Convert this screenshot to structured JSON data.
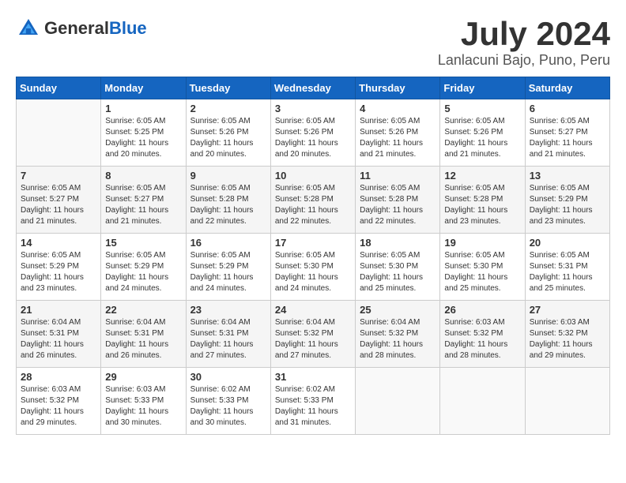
{
  "header": {
    "logo_general": "General",
    "logo_blue": "Blue",
    "month_year": "July 2024",
    "location": "Lanlacuni Bajo, Puno, Peru"
  },
  "days_of_week": [
    "Sunday",
    "Monday",
    "Tuesday",
    "Wednesday",
    "Thursday",
    "Friday",
    "Saturday"
  ],
  "weeks": [
    [
      {
        "day": "",
        "info": ""
      },
      {
        "day": "1",
        "info": "Sunrise: 6:05 AM\nSunset: 5:25 PM\nDaylight: 11 hours\nand 20 minutes."
      },
      {
        "day": "2",
        "info": "Sunrise: 6:05 AM\nSunset: 5:26 PM\nDaylight: 11 hours\nand 20 minutes."
      },
      {
        "day": "3",
        "info": "Sunrise: 6:05 AM\nSunset: 5:26 PM\nDaylight: 11 hours\nand 20 minutes."
      },
      {
        "day": "4",
        "info": "Sunrise: 6:05 AM\nSunset: 5:26 PM\nDaylight: 11 hours\nand 21 minutes."
      },
      {
        "day": "5",
        "info": "Sunrise: 6:05 AM\nSunset: 5:26 PM\nDaylight: 11 hours\nand 21 minutes."
      },
      {
        "day": "6",
        "info": "Sunrise: 6:05 AM\nSunset: 5:27 PM\nDaylight: 11 hours\nand 21 minutes."
      }
    ],
    [
      {
        "day": "7",
        "info": "Sunrise: 6:05 AM\nSunset: 5:27 PM\nDaylight: 11 hours\nand 21 minutes."
      },
      {
        "day": "8",
        "info": "Sunrise: 6:05 AM\nSunset: 5:27 PM\nDaylight: 11 hours\nand 21 minutes."
      },
      {
        "day": "9",
        "info": "Sunrise: 6:05 AM\nSunset: 5:28 PM\nDaylight: 11 hours\nand 22 minutes."
      },
      {
        "day": "10",
        "info": "Sunrise: 6:05 AM\nSunset: 5:28 PM\nDaylight: 11 hours\nand 22 minutes."
      },
      {
        "day": "11",
        "info": "Sunrise: 6:05 AM\nSunset: 5:28 PM\nDaylight: 11 hours\nand 22 minutes."
      },
      {
        "day": "12",
        "info": "Sunrise: 6:05 AM\nSunset: 5:28 PM\nDaylight: 11 hours\nand 23 minutes."
      },
      {
        "day": "13",
        "info": "Sunrise: 6:05 AM\nSunset: 5:29 PM\nDaylight: 11 hours\nand 23 minutes."
      }
    ],
    [
      {
        "day": "14",
        "info": "Sunrise: 6:05 AM\nSunset: 5:29 PM\nDaylight: 11 hours\nand 23 minutes."
      },
      {
        "day": "15",
        "info": "Sunrise: 6:05 AM\nSunset: 5:29 PM\nDaylight: 11 hours\nand 24 minutes."
      },
      {
        "day": "16",
        "info": "Sunrise: 6:05 AM\nSunset: 5:29 PM\nDaylight: 11 hours\nand 24 minutes."
      },
      {
        "day": "17",
        "info": "Sunrise: 6:05 AM\nSunset: 5:30 PM\nDaylight: 11 hours\nand 24 minutes."
      },
      {
        "day": "18",
        "info": "Sunrise: 6:05 AM\nSunset: 5:30 PM\nDaylight: 11 hours\nand 25 minutes."
      },
      {
        "day": "19",
        "info": "Sunrise: 6:05 AM\nSunset: 5:30 PM\nDaylight: 11 hours\nand 25 minutes."
      },
      {
        "day": "20",
        "info": "Sunrise: 6:05 AM\nSunset: 5:31 PM\nDaylight: 11 hours\nand 25 minutes."
      }
    ],
    [
      {
        "day": "21",
        "info": "Sunrise: 6:04 AM\nSunset: 5:31 PM\nDaylight: 11 hours\nand 26 minutes."
      },
      {
        "day": "22",
        "info": "Sunrise: 6:04 AM\nSunset: 5:31 PM\nDaylight: 11 hours\nand 26 minutes."
      },
      {
        "day": "23",
        "info": "Sunrise: 6:04 AM\nSunset: 5:31 PM\nDaylight: 11 hours\nand 27 minutes."
      },
      {
        "day": "24",
        "info": "Sunrise: 6:04 AM\nSunset: 5:32 PM\nDaylight: 11 hours\nand 27 minutes."
      },
      {
        "day": "25",
        "info": "Sunrise: 6:04 AM\nSunset: 5:32 PM\nDaylight: 11 hours\nand 28 minutes."
      },
      {
        "day": "26",
        "info": "Sunrise: 6:03 AM\nSunset: 5:32 PM\nDaylight: 11 hours\nand 28 minutes."
      },
      {
        "day": "27",
        "info": "Sunrise: 6:03 AM\nSunset: 5:32 PM\nDaylight: 11 hours\nand 29 minutes."
      }
    ],
    [
      {
        "day": "28",
        "info": "Sunrise: 6:03 AM\nSunset: 5:32 PM\nDaylight: 11 hours\nand 29 minutes."
      },
      {
        "day": "29",
        "info": "Sunrise: 6:03 AM\nSunset: 5:33 PM\nDaylight: 11 hours\nand 30 minutes."
      },
      {
        "day": "30",
        "info": "Sunrise: 6:02 AM\nSunset: 5:33 PM\nDaylight: 11 hours\nand 30 minutes."
      },
      {
        "day": "31",
        "info": "Sunrise: 6:02 AM\nSunset: 5:33 PM\nDaylight: 11 hours\nand 31 minutes."
      },
      {
        "day": "",
        "info": ""
      },
      {
        "day": "",
        "info": ""
      },
      {
        "day": "",
        "info": ""
      }
    ]
  ]
}
